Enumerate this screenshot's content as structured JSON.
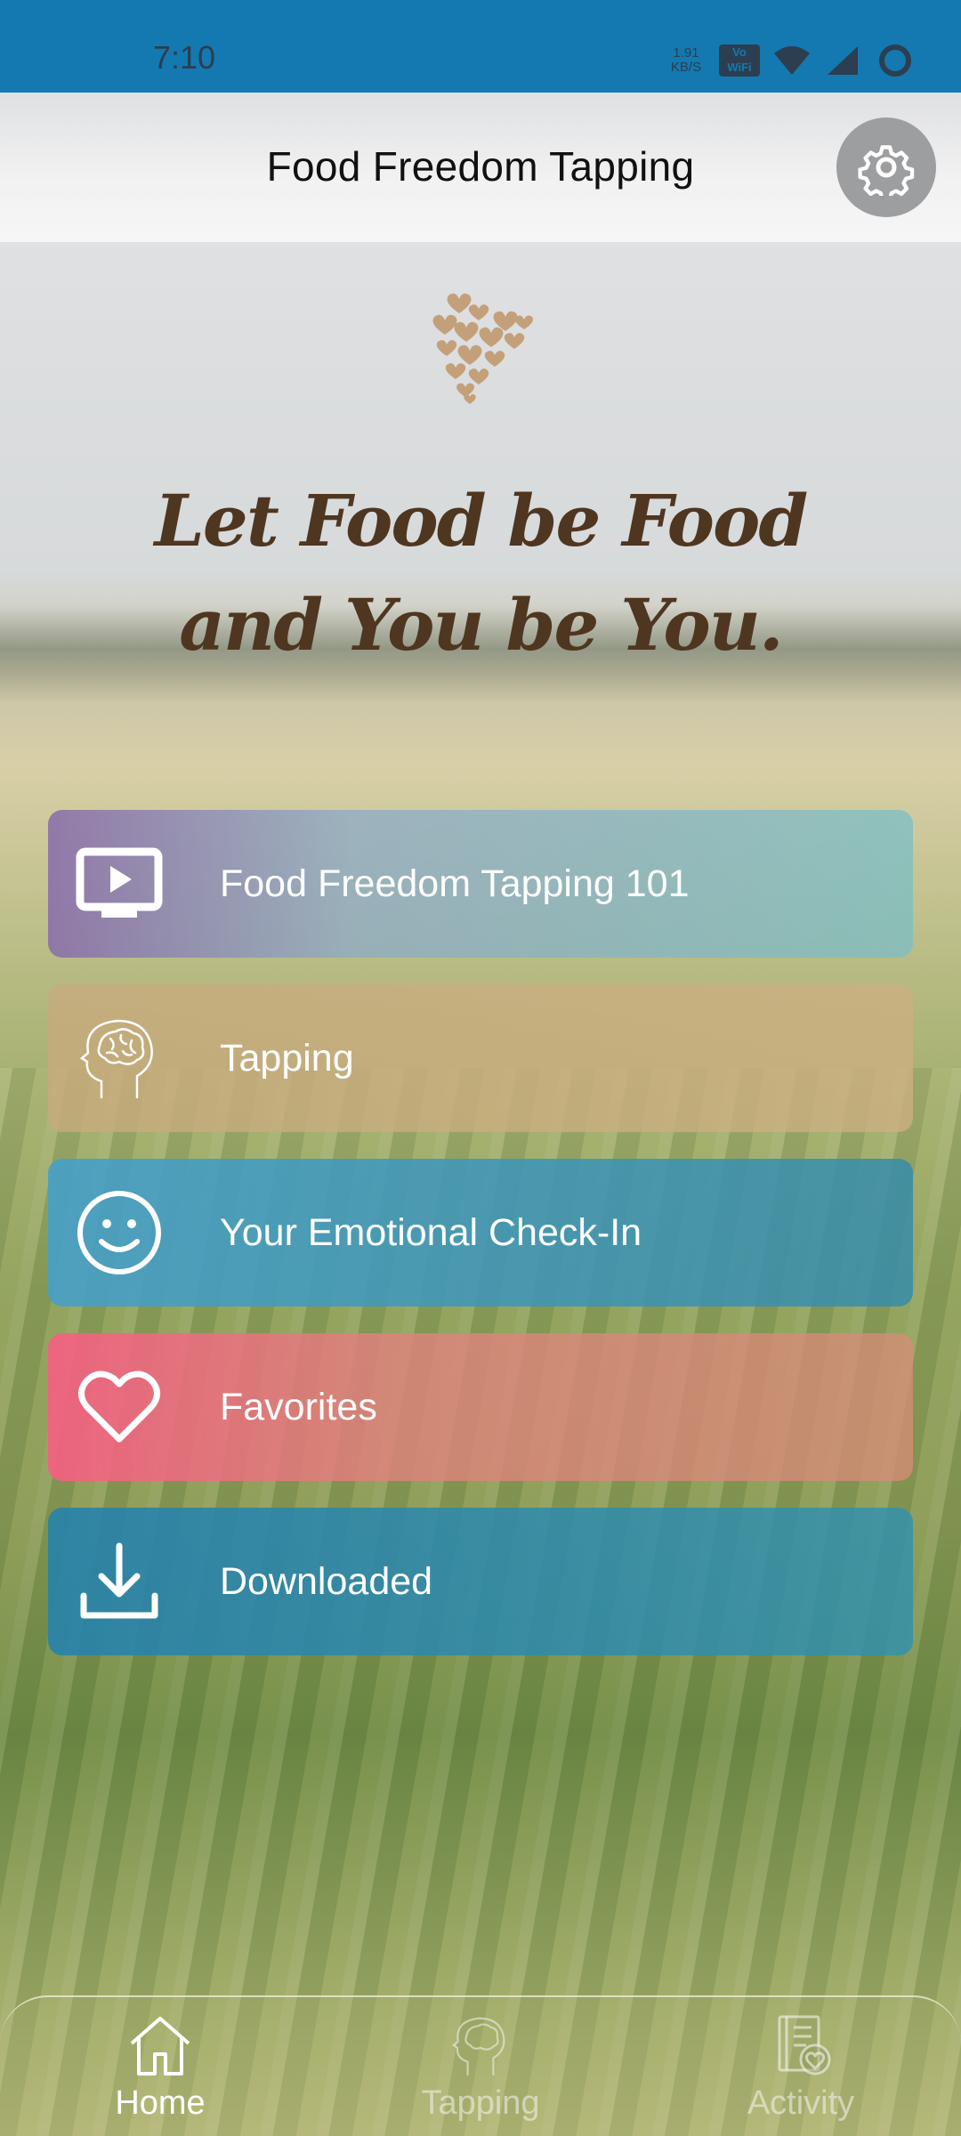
{
  "status_bar": {
    "time": "7:10",
    "net_speed_value": "1.91",
    "net_speed_unit": "KB/S",
    "volte_line1": "Vo",
    "volte_line2": "WiFi",
    "icons": [
      "wifi-icon",
      "signal-icon",
      "battery-icon"
    ]
  },
  "header": {
    "title": "Food Freedom Tapping",
    "settings_icon": "gear-icon"
  },
  "hero": {
    "logo_icon": "heart-logo-icon",
    "tagline_line1": "Let Food be Food",
    "tagline_line2": "and You be You."
  },
  "menu": {
    "items": [
      {
        "label": "Food Freedom Tapping 101",
        "icon": "video-play-icon"
      },
      {
        "label": "Tapping",
        "icon": "brain-head-icon"
      },
      {
        "label": "Your Emotional Check-In",
        "icon": "smiley-icon"
      },
      {
        "label": "Favorites",
        "icon": "heart-icon"
      },
      {
        "label": "Downloaded",
        "icon": "download-icon"
      }
    ]
  },
  "bottom_nav": {
    "items": [
      {
        "label": "Home",
        "icon": "home-icon",
        "active": true
      },
      {
        "label": "Tapping",
        "icon": "brain-head-icon",
        "active": false
      },
      {
        "label": "Activity",
        "icon": "journal-heart-icon",
        "active": false
      }
    ]
  },
  "colors": {
    "status_bar": "#1479b0",
    "tagline": "#4f3620",
    "logo": "#c4a07a"
  }
}
